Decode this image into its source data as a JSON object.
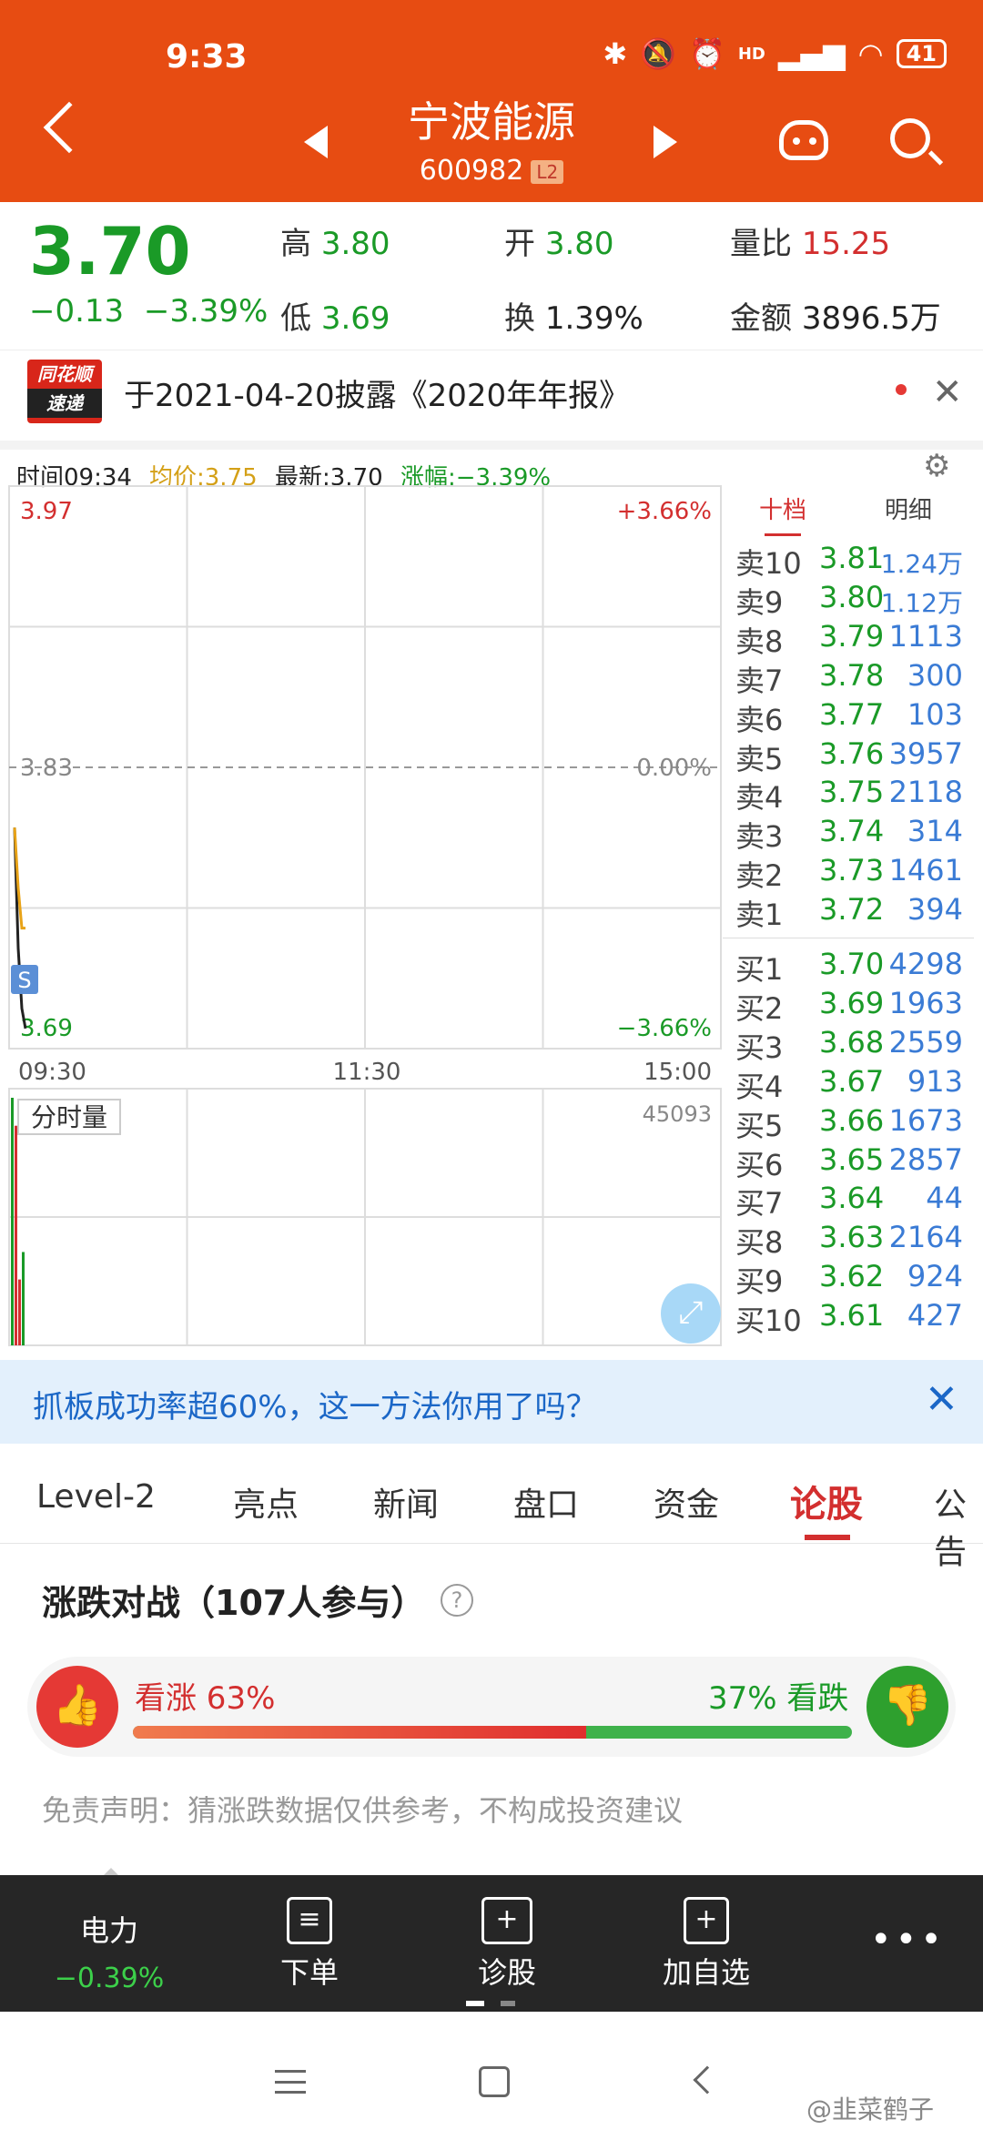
{
  "status_bar": {
    "time": "9:33",
    "battery": "41",
    "hd": "HD"
  },
  "header": {
    "name": "宁波能源",
    "code": "600982",
    "level": "L2"
  },
  "quote": {
    "price": "3.70",
    "change": "−0.13",
    "change_pct": "−3.39%",
    "high_label": "高",
    "high": "3.80",
    "low_label": "低",
    "low": "3.69",
    "open_label": "开",
    "open": "3.80",
    "turnover_label": "换",
    "turnover": "1.39%",
    "vol_ratio_label": "量比",
    "vol_ratio": "15.25",
    "amount_label": "金额",
    "amount": "3896.5万"
  },
  "news": {
    "logo_top": "同花顺",
    "logo_bottom": "速递",
    "text": "于2021-04-20披露《2020年年报》"
  },
  "chart_header": {
    "time": "时间09:34",
    "avg": "均价:3.75",
    "latest": "最新:3.70",
    "pct": "涨幅:−3.39%"
  },
  "chart_data": {
    "type": "line",
    "title": "",
    "x_ticks": [
      "09:30",
      "11:30",
      "15:00"
    ],
    "y_left_ticks": [
      "3.97",
      "3.83",
      "3.69"
    ],
    "y_right_ticks": [
      "+3.66%",
      "0.00%",
      "−3.66%"
    ],
    "ylim": [
      3.69,
      3.97
    ],
    "prev_close": 3.83,
    "series": [
      {
        "values": [
          3.8,
          3.74,
          3.71,
          3.7
        ]
      },
      {
        "values": [
          3.8,
          3.77,
          3.75,
          3.75
        ]
      }
    ],
    "marker": "S",
    "volume_label": "分时量",
    "volume_max": "45093",
    "volume_values": [
      45093,
      40000,
      12000,
      17000
    ]
  },
  "order_book": {
    "tabs": [
      "十档",
      "明细"
    ],
    "asks": [
      {
        "label": "卖10",
        "price": "3.81",
        "vol": "1.24万"
      },
      {
        "label": "卖9",
        "price": "3.80",
        "vol": "1.12万"
      },
      {
        "label": "卖8",
        "price": "3.79",
        "vol": "1113"
      },
      {
        "label": "卖7",
        "price": "3.78",
        "vol": "300"
      },
      {
        "label": "卖6",
        "price": "3.77",
        "vol": "103"
      },
      {
        "label": "卖5",
        "price": "3.76",
        "vol": "3957"
      },
      {
        "label": "卖4",
        "price": "3.75",
        "vol": "2118"
      },
      {
        "label": "卖3",
        "price": "3.74",
        "vol": "314"
      },
      {
        "label": "卖2",
        "price": "3.73",
        "vol": "1461"
      },
      {
        "label": "卖1",
        "price": "3.72",
        "vol": "394"
      }
    ],
    "bids": [
      {
        "label": "买1",
        "price": "3.70",
        "vol": "4298"
      },
      {
        "label": "买2",
        "price": "3.69",
        "vol": "1963"
      },
      {
        "label": "买3",
        "price": "3.68",
        "vol": "2559"
      },
      {
        "label": "买4",
        "price": "3.67",
        "vol": "913"
      },
      {
        "label": "买5",
        "price": "3.66",
        "vol": "1673"
      },
      {
        "label": "买6",
        "price": "3.65",
        "vol": "2857"
      },
      {
        "label": "买7",
        "price": "3.64",
        "vol": "44"
      },
      {
        "label": "买8",
        "price": "3.63",
        "vol": "2164"
      },
      {
        "label": "买9",
        "price": "3.62",
        "vol": "924"
      },
      {
        "label": "买10",
        "price": "3.61",
        "vol": "427"
      }
    ]
  },
  "banner": {
    "text": "抓板成功率超60%，这一方法你用了吗？"
  },
  "tabs": [
    "Level-2",
    "亮点",
    "新闻",
    "盘口",
    "资金",
    "论股",
    "公告"
  ],
  "active_tab": "论股",
  "vote": {
    "title": "涨跌对战（107人参与）",
    "up_text": "看涨  63%",
    "down_text": "37%  看跌",
    "up_pct": 63,
    "disclaimer": "免责声明：猜涨跌数据仅供参考，不构成投资建议"
  },
  "toolbar": {
    "sector": "电力",
    "sector_pct": "−0.39%",
    "order": "下单",
    "diagnose": "诊股",
    "watch": "加自选"
  },
  "watermark": "@韭菜鹤子",
  "colors": {
    "accent": "#e74c12",
    "up": "#d32f2f",
    "down": "#1a9a27"
  }
}
